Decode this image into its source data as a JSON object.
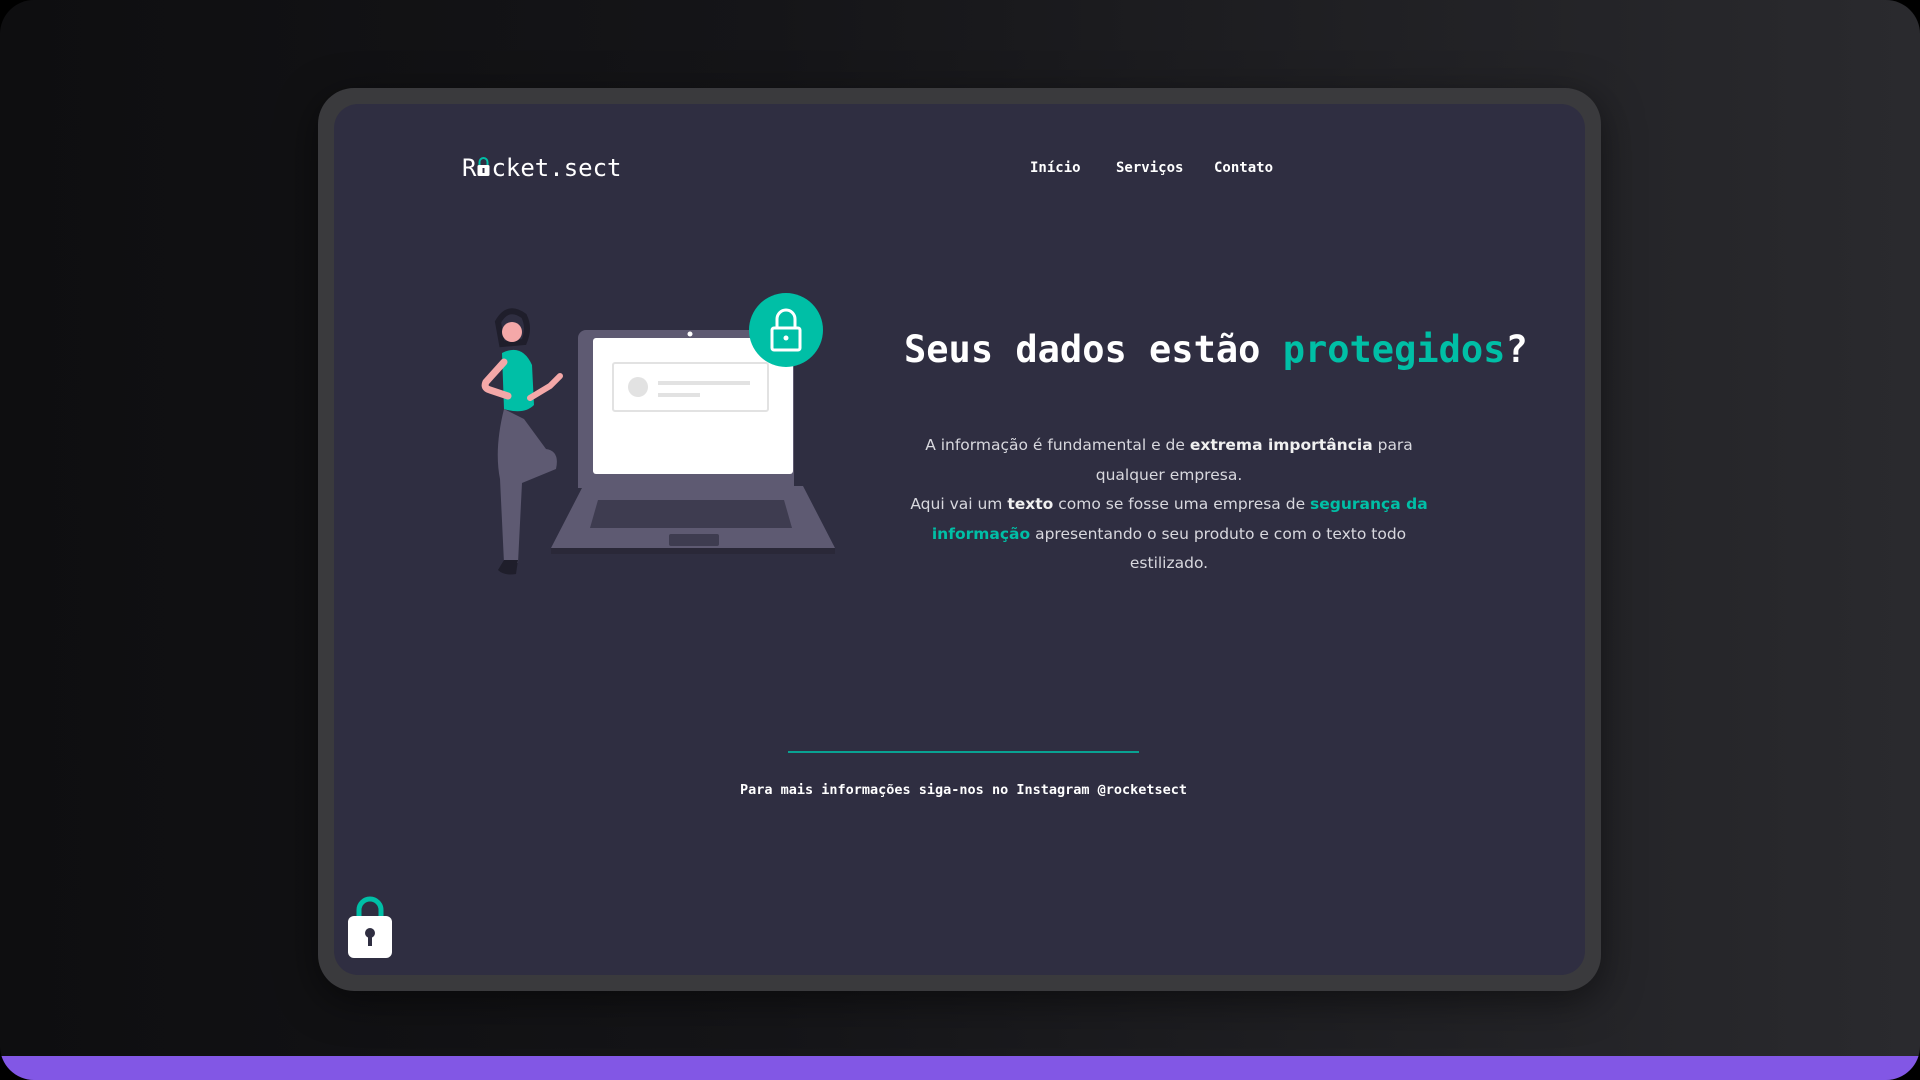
{
  "brand": {
    "logo": "Rocket.sect",
    "logo_prefix": "R",
    "logo_suffix": "cket.sect"
  },
  "nav": [
    {
      "label": "Início"
    },
    {
      "label": "Serviços"
    },
    {
      "label": "Contato"
    }
  ],
  "hero": {
    "title_pre": "Seus dados estão ",
    "title_accent": "protegidos",
    "title_post": "?",
    "p1_a": "A informação é fundamental e de ",
    "p1_b": "extrema importância",
    "p1_c": " para qualquer empresa.",
    "p2_a": "Aqui vai um ",
    "p2_b": "texto",
    "p2_c": " como se fosse uma empresa de ",
    "p2_d": "segurança da informação",
    "p2_e": " apresentando o seu produto e com o texto todo estilizado."
  },
  "footer": {
    "text": "Para mais informações siga-nos no Instagram @rocketsect"
  },
  "colors": {
    "background": "#2f2e41",
    "accent": "#00bfa6",
    "bar": "#8257e5"
  }
}
